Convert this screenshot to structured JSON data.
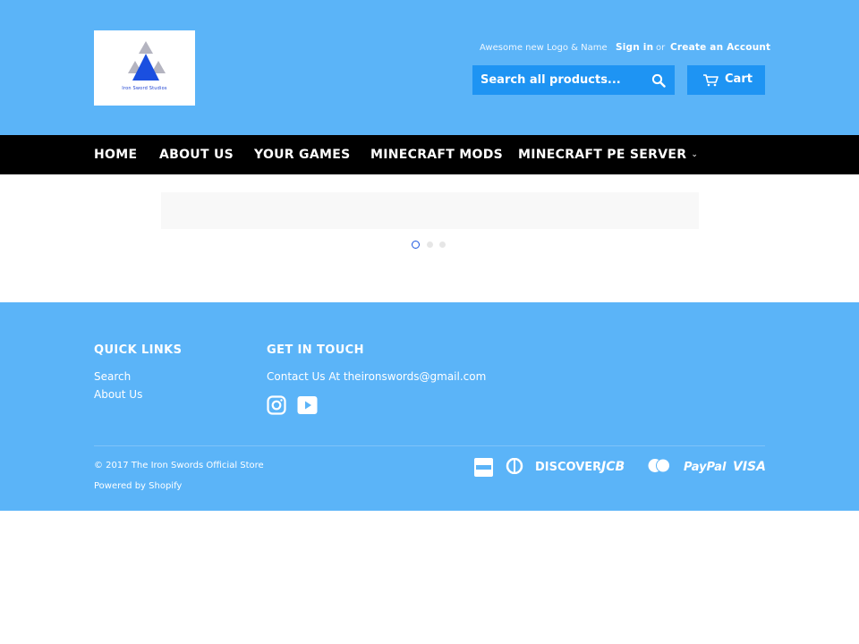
{
  "header": {
    "logo_text": "Iron Sword Studios",
    "tagline": "Awesome new Logo & Name",
    "sign_in": "Sign in",
    "or": "or",
    "create_account": "Create an Account",
    "search_placeholder": "Search all products...",
    "cart_label": "Cart",
    "icons": {
      "search": "search-icon",
      "cart": "cart-icon"
    }
  },
  "nav": {
    "items": [
      {
        "label": "HOME"
      },
      {
        "label": "ABOUT US"
      },
      {
        "label": "YOUR GAMES"
      },
      {
        "label": "MINECRAFT MODS"
      },
      {
        "label": "MINECRAFT PE SERVER",
        "has_dropdown": true
      }
    ]
  },
  "slideshow": {
    "slides": 3,
    "active": 1
  },
  "footer": {
    "quick_links_title": "QUICK LINKS",
    "quick_links": [
      "Search",
      "About Us"
    ],
    "get_in_touch_title": "GET IN TOUCH",
    "contact": "Contact Us At theironswords@gmail.com",
    "social": [
      "instagram-icon",
      "youtube-icon"
    ],
    "copyright": "© 2017 The Iron Swords Official Store",
    "powered_by": "Powered by Shopify",
    "payments": [
      "American Express",
      "Diners Club",
      "DISCOVER",
      "JCB",
      "Master",
      "PayPal",
      "VISA"
    ]
  },
  "colors": {
    "brand_blue": "#5bb4f8",
    "button_blue": "#1e94f3",
    "nav_black": "#000000"
  }
}
